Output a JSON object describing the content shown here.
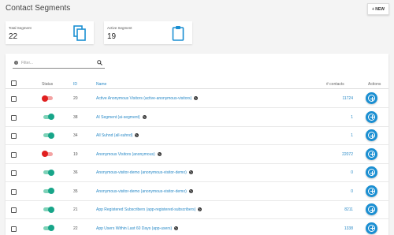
{
  "header": {
    "title": "Contact Segments",
    "new_button": "+ NEW"
  },
  "stats": [
    {
      "label": "Total Segment",
      "value": "22",
      "icon": "copy-icon"
    },
    {
      "label": "Active Segment",
      "value": "19",
      "icon": "clipboard-icon"
    }
  ],
  "filter": {
    "placeholder": "Filter..."
  },
  "table": {
    "columns": {
      "status": "Status",
      "id": "ID",
      "name": "Name",
      "contacts": "# contacts",
      "actions": "Actions"
    },
    "rows": [
      {
        "active": false,
        "id": "20",
        "name": "Active Anonymous Visitors (active-anonymous-visitors)",
        "contacts": "11724"
      },
      {
        "active": true,
        "id": "38",
        "name": "AI Segment (ai-segment)",
        "contacts": "1"
      },
      {
        "active": true,
        "id": "34",
        "name": "All Suhnd (all-suhnd)",
        "contacts": "1"
      },
      {
        "active": false,
        "id": "19",
        "name": "Anonymous Visitors (anonymous)",
        "contacts": "22072"
      },
      {
        "active": true,
        "id": "36",
        "name": "Anonymous-visitor-demo (anonymous-visitor-demo)",
        "contacts": "0"
      },
      {
        "active": true,
        "id": "35",
        "name": "Anonymous-visitor-demo (anonymous-visitor-demo)",
        "contacts": "0"
      },
      {
        "active": true,
        "id": "21",
        "name": "App Registered Subscribers (app-registered-subscribers)",
        "contacts": "8211"
      },
      {
        "active": true,
        "id": "22",
        "name": "App Users Within Last 60 Days (app-users)",
        "contacts": "1338"
      }
    ]
  },
  "colors": {
    "accent": "#1b8fd2",
    "link": "#2a8ac7",
    "toggle_on": "#17a589",
    "toggle_off": "#e02020"
  }
}
